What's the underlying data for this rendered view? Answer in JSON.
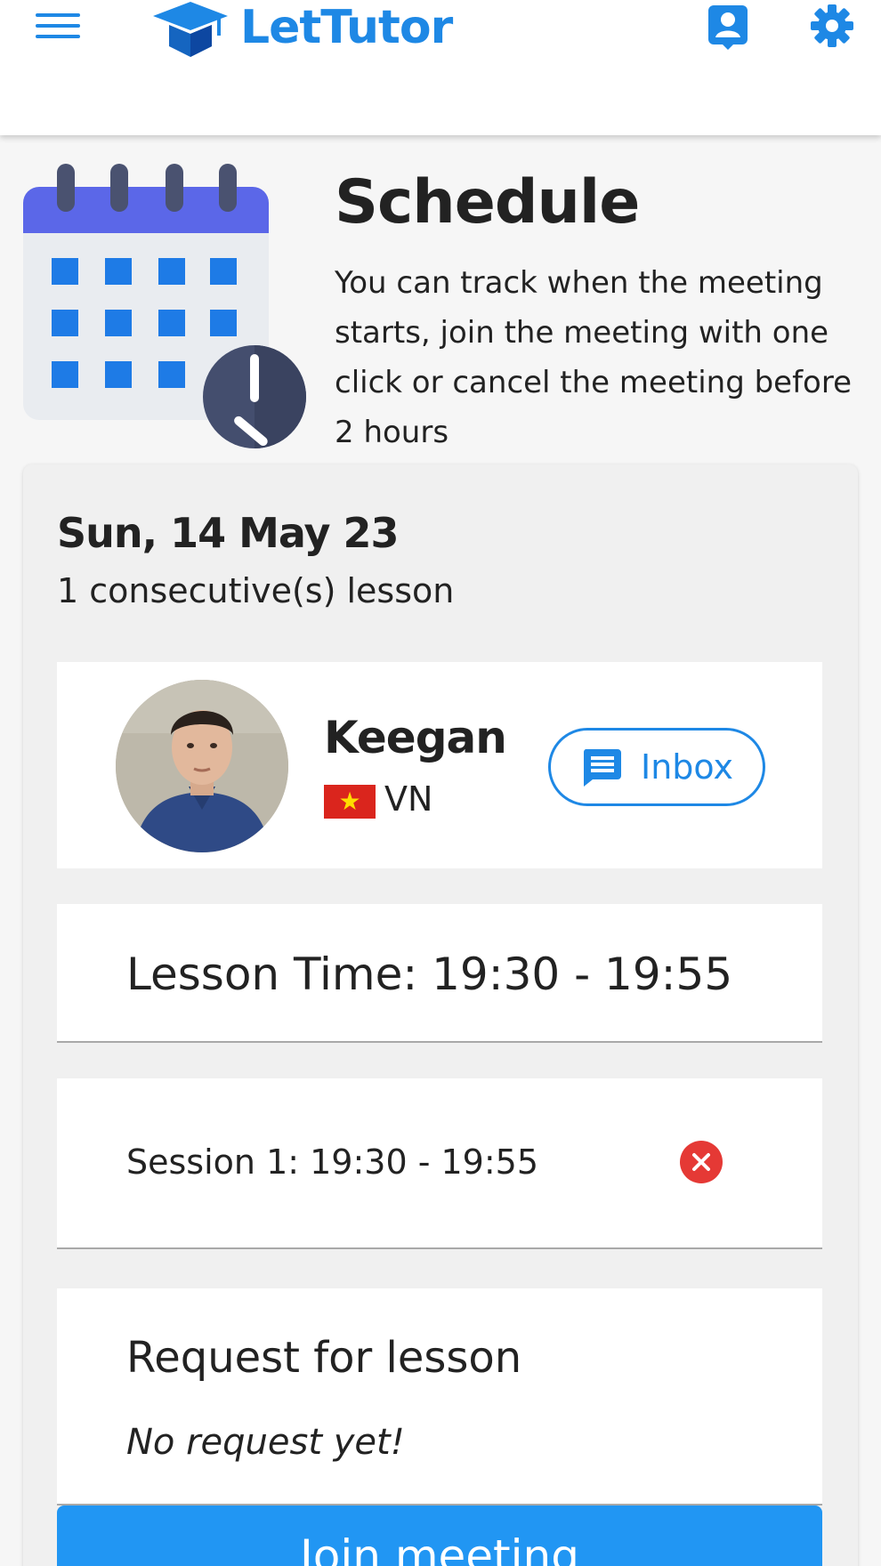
{
  "header": {
    "brand_name": "LetTutor",
    "icons": {
      "menu": "hamburger-menu-icon",
      "profile": "user-profile-icon",
      "settings": "gear-icon"
    },
    "brand_color": "#1e88e5"
  },
  "hero": {
    "title": "Schedule",
    "description": "You can track when the meeting starts, join the meeting with one click or cancel the meeting before 2 hours"
  },
  "booking": {
    "date": "Sun, 14 May 23",
    "lesson_count": "1 consecutive(s) lesson",
    "tutor": {
      "name": "Keegan",
      "country": "VN",
      "inbox_label": "Inbox"
    },
    "lesson_time": "Lesson Time: 19:30 - 19:55",
    "session": "Session 1: 19:30 - 19:55",
    "request": {
      "title": "Request for lesson",
      "empty_text": "No request yet!"
    },
    "join_label": "Join meeting"
  },
  "colors": {
    "accent": "#2196f3",
    "cancel": "#e53935",
    "card": "#f0f0f0"
  }
}
